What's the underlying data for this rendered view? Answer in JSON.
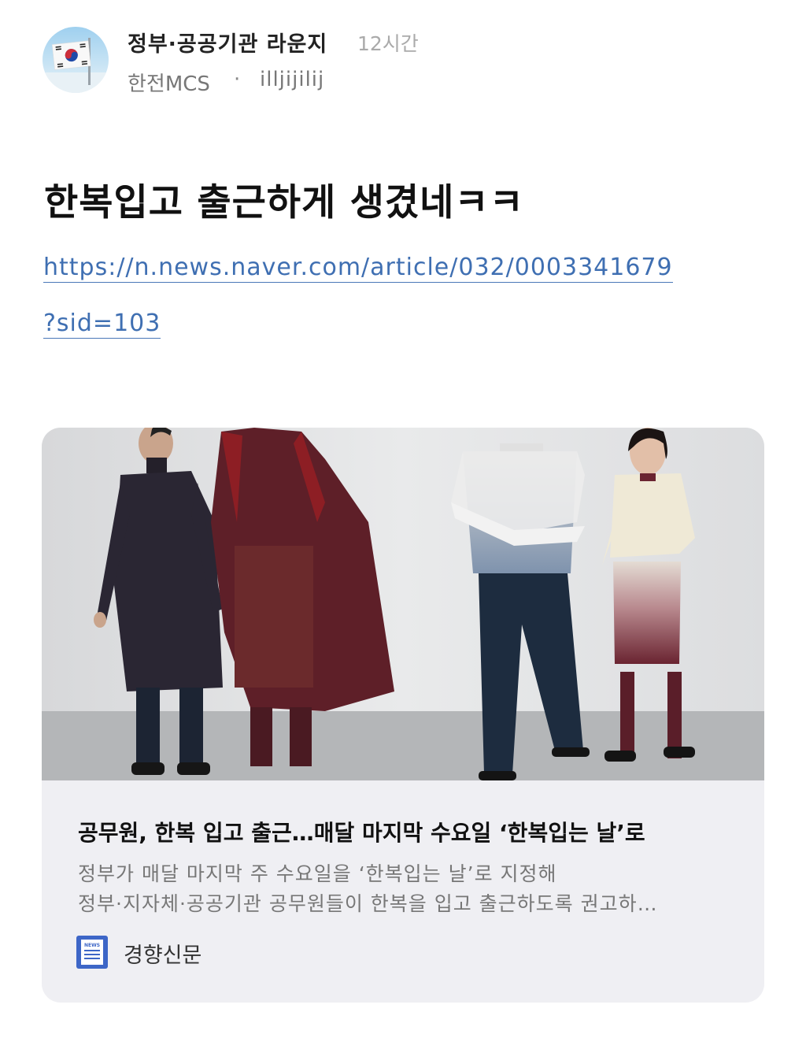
{
  "post": {
    "lounge": "정부·공공기관 라운지",
    "time": "12시간",
    "company": "한전MCS",
    "separator": "·",
    "username": "illjijilij",
    "title": "한복입고 출근하게 생겼네ㅋㅋ",
    "link_line1": "https://n.news.naver.com/article/032/0003341679",
    "link_line2": "?sid=103"
  },
  "card": {
    "headline": "공무원, 한복 입고 출근…매달 마지막 수요일 ‘한복입는 날’로",
    "description_line1": "정부가 매달 마지막 주 수요일을 ‘한복입는 날’로 지정해",
    "description_line2": "정부·지자체·공공기관 공무원들이 한복을 입고 출근하도록 권고하…",
    "source": "경향신문",
    "news_icon_text": "NEWS"
  },
  "colors": {
    "link": "#3f6fb2",
    "card_bg": "#efeff3",
    "news_icon": "#3d66c7"
  },
  "icons": {
    "avatar": "korean-flag-avatar",
    "source": "news-icon"
  }
}
